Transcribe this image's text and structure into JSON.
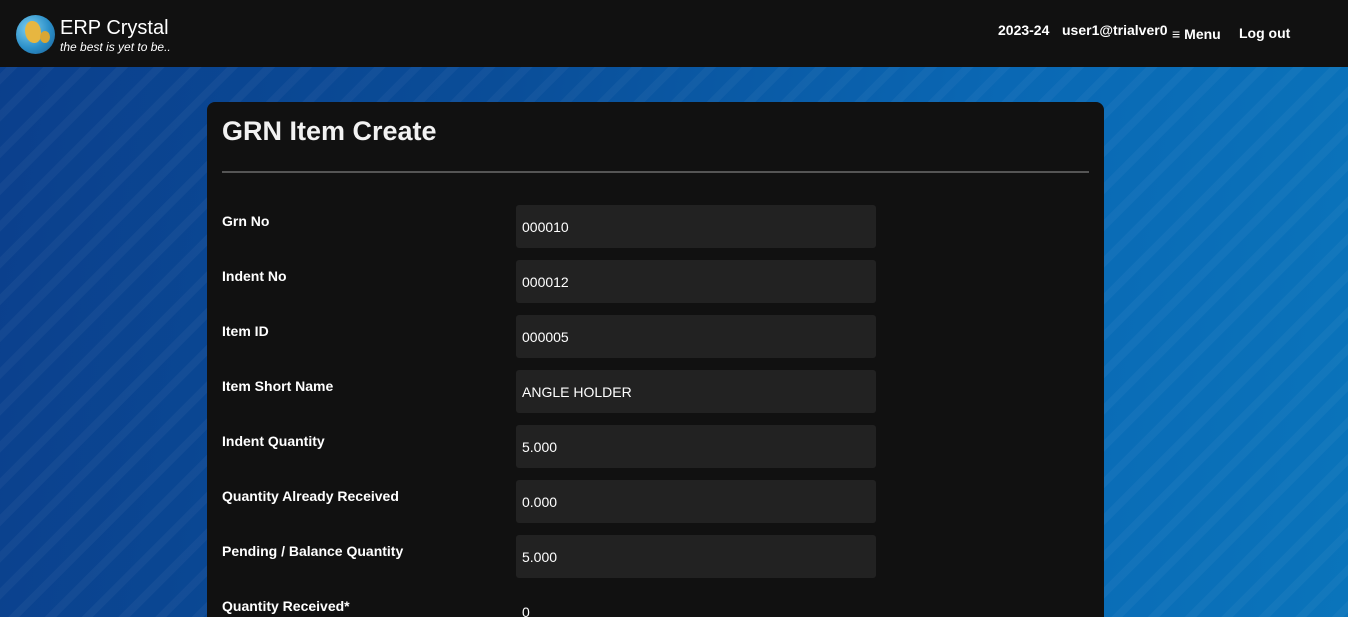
{
  "brand": {
    "name": "ERP Crystal",
    "tagline": "the best is yet to be.."
  },
  "nav": {
    "year": "2023-24",
    "user": "user1@trialver0",
    "menu_icon": "≡",
    "menu_label": "Menu",
    "logout_label": "Log out"
  },
  "page": {
    "title": "GRN Item Create"
  },
  "form": {
    "fields": [
      {
        "label": "Grn No",
        "value": "000010"
      },
      {
        "label": "Indent No",
        "value": "000012"
      },
      {
        "label": "Item ID",
        "value": "000005"
      },
      {
        "label": "Item Short Name",
        "value": "ANGLE HOLDER"
      },
      {
        "label": "Indent Quantity",
        "value": "5.000"
      },
      {
        "label": "Quantity Already Received",
        "value": "0.000"
      },
      {
        "label": "Pending / Balance Quantity",
        "value": "5.000"
      },
      {
        "label": "Quantity Received*",
        "value": "0"
      }
    ]
  },
  "colors": {
    "topbar": "#111111",
    "card": "#111111",
    "input_bg": "#222222",
    "background_blue": "#0a5aa6"
  }
}
